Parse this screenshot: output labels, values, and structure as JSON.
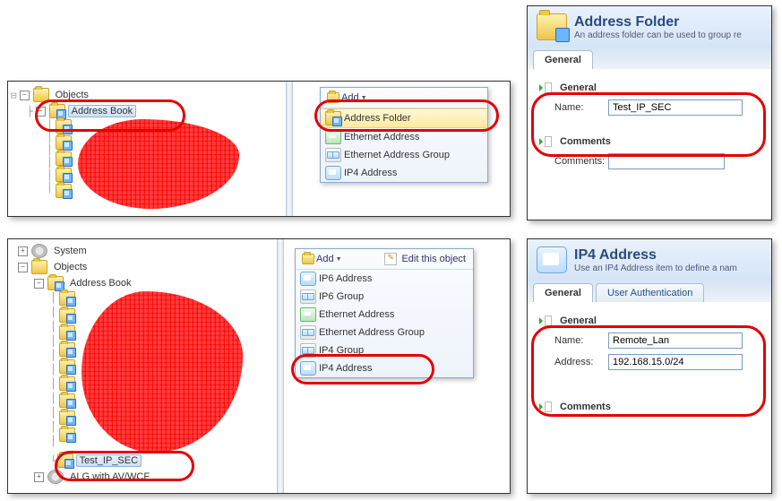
{
  "panel_top_left": {
    "tree": {
      "objects": "Objects",
      "address_book": "Address Book"
    }
  },
  "panel_bottom_left": {
    "tree": {
      "system": "System",
      "objects": "Objects",
      "address_book": "Address Book",
      "test_ipsec": "Test_IP_SEC",
      "alg": "ALG with AV/WCF"
    }
  },
  "menu1": {
    "add": "Add",
    "items": {
      "address_folder": "Address Folder",
      "eth_addr": "Ethernet Address",
      "eth_grp": "Ethernet Address Group",
      "ip4_addr": "IP4 Address"
    }
  },
  "menu2": {
    "add": "Add",
    "edit": "Edit this object",
    "items": {
      "ip6_addr": "IP6 Address",
      "ip6_grp": "IP6 Group",
      "eth_addr": "Ethernet Address",
      "eth_grp": "Ethernet Address Group",
      "ip4_grp": "IP4 Group",
      "ip4_addr": "IP4 Address"
    }
  },
  "form_af": {
    "title": "Address Folder",
    "subtitle": "An address folder can be used to group re",
    "tab_general": "General",
    "section_general": "General",
    "name_label": "Name:",
    "name_value": "Test_IP_SEC",
    "section_comments": "Comments",
    "comments_label": "Comments:"
  },
  "form_ip4": {
    "title": "IP4 Address",
    "subtitle": "Use an IP4 Address item to define a nam",
    "tab_general": "General",
    "tab_ua": "User Authentication",
    "section_general": "General",
    "name_label": "Name:",
    "name_value": "Remote_Lan",
    "addr_label": "Address:",
    "addr_value": "192.168.15.0/24",
    "section_comments": "Comments"
  }
}
